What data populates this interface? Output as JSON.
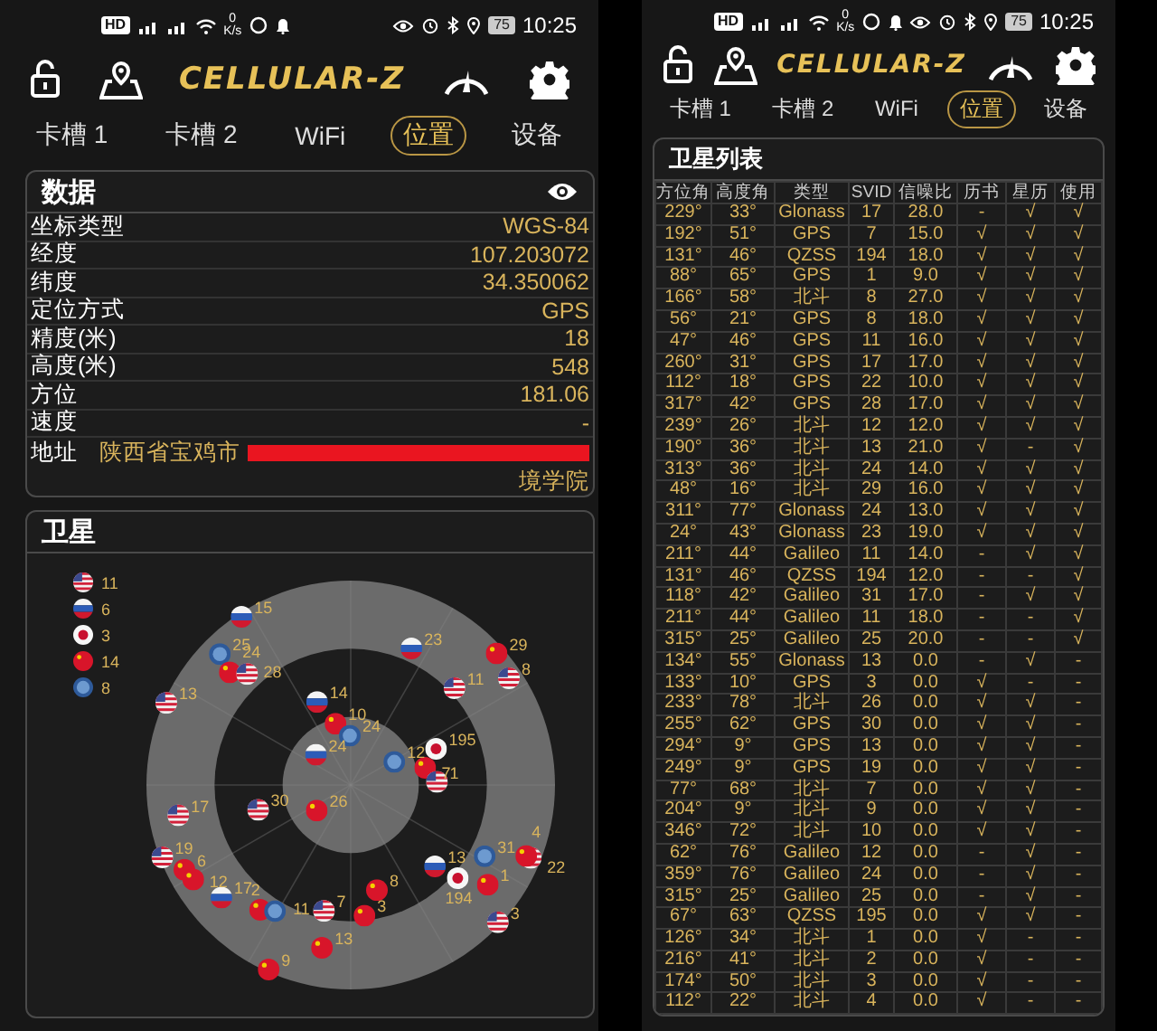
{
  "screens": [
    {
      "kind": "data",
      "status_bar": {
        "left_badge": "HD",
        "speed_value": "0",
        "speed_unit": "K/s",
        "battery": "75",
        "time": "10:25"
      },
      "app_title": "CELLULAR-Z",
      "tabs": [
        {
          "label": "卡槽 1",
          "selected": false
        },
        {
          "label": "卡槽 2",
          "selected": false
        },
        {
          "label": "WiFi",
          "selected": false
        },
        {
          "label": "位置",
          "selected": true
        },
        {
          "label": "设备",
          "selected": false
        }
      ],
      "data_panel": {
        "title": "数据",
        "rows": [
          {
            "label": "坐标类型",
            "value": "WGS-84"
          },
          {
            "label": "经度",
            "value": "107.203072"
          },
          {
            "label": "纬度",
            "value": "34.350062"
          },
          {
            "label": "定位方式",
            "value": "GPS"
          },
          {
            "label": "精度(米)",
            "value": "18"
          },
          {
            "label": "高度(米)",
            "value": "548"
          },
          {
            "label": "方位",
            "value": "181.06"
          },
          {
            "label": "速度",
            "value": "-"
          }
        ],
        "address": {
          "label": "地址",
          "value_start": "陕西省宝鸡市",
          "value_end": "境学院",
          "redacted": true
        }
      },
      "sky_panel": {
        "title": "卫星",
        "legend": [
          {
            "kind": "gps",
            "count": "11"
          },
          {
            "kind": "glonass",
            "count": "6"
          },
          {
            "kind": "qzss",
            "count": "3"
          },
          {
            "kind": "beidou",
            "count": "14"
          },
          {
            "kind": "galileo",
            "count": "8"
          }
        ],
        "satellites": [
          {
            "kind": "glonass",
            "label": "15"
          },
          {
            "kind": "galileo",
            "label": "25"
          },
          {
            "kind": "beidou",
            "label": "24"
          },
          {
            "kind": "gps",
            "label": "28"
          },
          {
            "kind": "gps",
            "label": "13"
          },
          {
            "kind": "glonass",
            "label": "23"
          },
          {
            "kind": "beidou",
            "label": "29"
          },
          {
            "kind": "gps",
            "label": "8"
          },
          {
            "kind": "gps",
            "label": "11"
          },
          {
            "kind": "glonass",
            "label": "14"
          },
          {
            "kind": "beidou",
            "label": "10"
          },
          {
            "kind": "galileo",
            "label": "24"
          },
          {
            "kind": "glonass",
            "label": "24"
          },
          {
            "kind": "galileo",
            "label": "12"
          },
          {
            "kind": "qzss",
            "label": "195"
          },
          {
            "kind": "beidou",
            "label": "7"
          },
          {
            "kind": "gps",
            "label": "1"
          },
          {
            "kind": "gps",
            "label": "17"
          },
          {
            "kind": "gps",
            "label": "30"
          },
          {
            "kind": "beidou",
            "label": "26"
          },
          {
            "kind": "gps",
            "label": "19"
          },
          {
            "kind": "beidou",
            "label": "6"
          },
          {
            "kind": "beidou",
            "label": "12"
          },
          {
            "kind": "glonass",
            "label": "17"
          },
          {
            "kind": "beidou",
            "label": "2"
          },
          {
            "kind": "galileo",
            "label": "11"
          },
          {
            "kind": "gps",
            "label": "7"
          },
          {
            "kind": "beidou",
            "label": "8"
          },
          {
            "kind": "beidou",
            "label": "3"
          },
          {
            "kind": "glonass",
            "label": "13"
          },
          {
            "kind": "qzss",
            "label": "194"
          },
          {
            "kind": "galileo",
            "label": "31"
          },
          {
            "kind": "beidou",
            "label": "1"
          },
          {
            "kind": "gps",
            "label": "22"
          },
          {
            "kind": "beidou",
            "label": "4"
          },
          {
            "kind": "gps",
            "label": "3"
          },
          {
            "kind": "beidou",
            "label": "13"
          },
          {
            "kind": "beidou",
            "label": "9"
          }
        ]
      }
    },
    {
      "kind": "table",
      "status_bar": {
        "left_badge": "HD",
        "speed_value": "0",
        "speed_unit": "K/s",
        "battery": "75",
        "time": "10:25"
      },
      "app_title": "CELLULAR-Z",
      "tabs": [
        {
          "label": "卡槽 1",
          "selected": false
        },
        {
          "label": "卡槽 2",
          "selected": false
        },
        {
          "label": "WiFi",
          "selected": false
        },
        {
          "label": "位置",
          "selected": true
        },
        {
          "label": "设备",
          "selected": false
        }
      ],
      "table_panel": {
        "title": "卫星列表",
        "columns": [
          "方位角",
          "高度角",
          "类型",
          "SVID",
          "信噪比",
          "历书",
          "星历",
          "使用"
        ],
        "rows": [
          [
            "229°",
            "33°",
            "Glonass",
            "17",
            "28.0",
            "-",
            "√",
            "√"
          ],
          [
            "192°",
            "51°",
            "GPS",
            "7",
            "15.0",
            "√",
            "√",
            "√"
          ],
          [
            "131°",
            "46°",
            "QZSS",
            "194",
            "18.0",
            "√",
            "√",
            "√"
          ],
          [
            "88°",
            "65°",
            "GPS",
            "1",
            "9.0",
            "√",
            "√",
            "√"
          ],
          [
            "166°",
            "58°",
            "北斗",
            "8",
            "27.0",
            "√",
            "√",
            "√"
          ],
          [
            "56°",
            "21°",
            "GPS",
            "8",
            "18.0",
            "√",
            "√",
            "√"
          ],
          [
            "47°",
            "46°",
            "GPS",
            "11",
            "16.0",
            "√",
            "√",
            "√"
          ],
          [
            "260°",
            "31°",
            "GPS",
            "17",
            "17.0",
            "√",
            "√",
            "√"
          ],
          [
            "112°",
            "18°",
            "GPS",
            "22",
            "10.0",
            "√",
            "√",
            "√"
          ],
          [
            "317°",
            "42°",
            "GPS",
            "28",
            "17.0",
            "√",
            "√",
            "√"
          ],
          [
            "239°",
            "26°",
            "北斗",
            "12",
            "12.0",
            "√",
            "√",
            "√"
          ],
          [
            "190°",
            "36°",
            "北斗",
            "13",
            "21.0",
            "√",
            "-",
            "√"
          ],
          [
            "313°",
            "36°",
            "北斗",
            "24",
            "14.0",
            "√",
            "√",
            "√"
          ],
          [
            "48°",
            "16°",
            "北斗",
            "29",
            "16.0",
            "√",
            "√",
            "√"
          ],
          [
            "311°",
            "77°",
            "Glonass",
            "24",
            "13.0",
            "√",
            "√",
            "√"
          ],
          [
            "24°",
            "43°",
            "Glonass",
            "23",
            "19.0",
            "√",
            "√",
            "√"
          ],
          [
            "211°",
            "44°",
            "Galileo",
            "11",
            "14.0",
            "-",
            "√",
            "√"
          ],
          [
            "131°",
            "46°",
            "QZSS",
            "194",
            "12.0",
            "-",
            "-",
            "√"
          ],
          [
            "118°",
            "42°",
            "Galileo",
            "31",
            "17.0",
            "-",
            "√",
            "√"
          ],
          [
            "211°",
            "44°",
            "Galileo",
            "11",
            "18.0",
            "-",
            "-",
            "√"
          ],
          [
            "315°",
            "25°",
            "Galileo",
            "25",
            "20.0",
            "-",
            "-",
            "√"
          ],
          [
            "134°",
            "55°",
            "Glonass",
            "13",
            "0.0",
            "-",
            "√",
            "-"
          ],
          [
            "133°",
            "10°",
            "GPS",
            "3",
            "0.0",
            "√",
            "-",
            "-"
          ],
          [
            "233°",
            "78°",
            "北斗",
            "26",
            "0.0",
            "√",
            "√",
            "-"
          ],
          [
            "255°",
            "62°",
            "GPS",
            "30",
            "0.0",
            "√",
            "√",
            "-"
          ],
          [
            "294°",
            "9°",
            "GPS",
            "13",
            "0.0",
            "√",
            "√",
            "-"
          ],
          [
            "249°",
            "9°",
            "GPS",
            "19",
            "0.0",
            "√",
            "√",
            "-"
          ],
          [
            "77°",
            "68°",
            "北斗",
            "7",
            "0.0",
            "√",
            "√",
            "-"
          ],
          [
            "204°",
            "9°",
            "北斗",
            "9",
            "0.0",
            "√",
            "√",
            "-"
          ],
          [
            "346°",
            "72°",
            "北斗",
            "10",
            "0.0",
            "√",
            "√",
            "-"
          ],
          [
            "62°",
            "76°",
            "Galileo",
            "12",
            "0.0",
            "-",
            "√",
            "-"
          ],
          [
            "359°",
            "76°",
            "Galileo",
            "24",
            "0.0",
            "-",
            "√",
            "-"
          ],
          [
            "315°",
            "25°",
            "Galileo",
            "25",
            "0.0",
            "-",
            "√",
            "-"
          ],
          [
            "67°",
            "63°",
            "QZSS",
            "195",
            "0.0",
            "√",
            "√",
            "-"
          ],
          [
            "126°",
            "34°",
            "北斗",
            "1",
            "0.0",
            "√",
            "-",
            "-"
          ],
          [
            "216°",
            "41°",
            "北斗",
            "2",
            "0.0",
            "√",
            "-",
            "-"
          ],
          [
            "174°",
            "50°",
            "北斗",
            "3",
            "0.0",
            "√",
            "-",
            "-"
          ],
          [
            "112°",
            "22°",
            "北斗",
            "4",
            "0.0",
            "√",
            "-",
            "-"
          ]
        ]
      }
    }
  ]
}
